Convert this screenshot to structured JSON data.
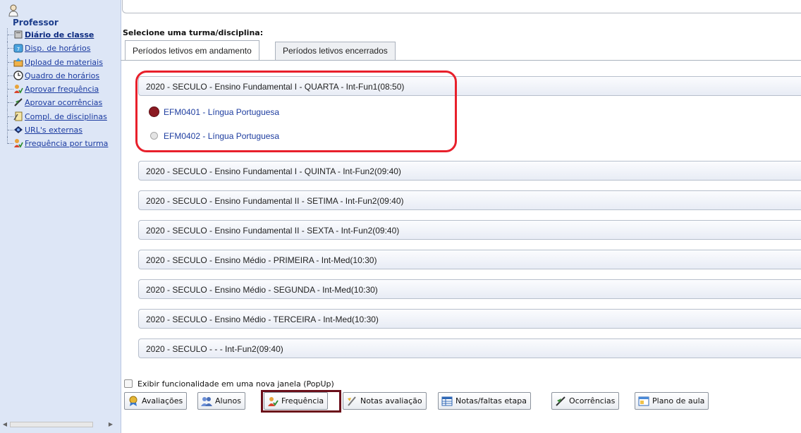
{
  "sidebar": {
    "title": "Professor",
    "items": [
      {
        "label": "Diário de classe",
        "icon": "book-icon"
      },
      {
        "label": "Disp. de horários",
        "icon": "calendar-icon"
      },
      {
        "label": "Upload de materiais",
        "icon": "upload-icon"
      },
      {
        "label": "Quadro de horários",
        "icon": "clock-icon"
      },
      {
        "label": "Aprovar frequência",
        "icon": "attendance-icon"
      },
      {
        "label": "Aprovar ocorrências",
        "icon": "occurrence-icon"
      },
      {
        "label": "Compl. de disciplinas",
        "icon": "complement-icon"
      },
      {
        "label": "URL's externas",
        "icon": "globe-icon"
      },
      {
        "label": "Frequência por turma",
        "icon": "attendance-icon"
      }
    ]
  },
  "main": {
    "select_label": "Selecione uma turma/disciplina:",
    "tabs": [
      {
        "label": "Períodos letivos em andamento",
        "active": true
      },
      {
        "label": "Períodos letivos encerrados",
        "active": false
      }
    ],
    "groups": [
      {
        "title": "2020 - SECULO  - Ensino Fundamental I - QUARTA - Int-Fun1(08:50)",
        "expanded": true,
        "disciplines": [
          {
            "label": "EFM0401 - Língua Portuguesa",
            "selected": true
          },
          {
            "label": "EFM0402 - Língua Portuguesa",
            "selected": false
          }
        ]
      },
      {
        "title": "2020 - SECULO  - Ensino Fundamental I - QUINTA - Int-Fun2(09:40)"
      },
      {
        "title": "2020 - SECULO  - Ensino Fundamental II - SETIMA - Int-Fun2(09:40)"
      },
      {
        "title": "2020 - SECULO  - Ensino Fundamental II - SEXTA - Int-Fun2(09:40)"
      },
      {
        "title": "2020 - SECULO  - Ensino Médio - PRIMEIRA - Int-Med(10:30)"
      },
      {
        "title": "2020 - SECULO  - Ensino Médio - SEGUNDA - Int-Med(10:30)"
      },
      {
        "title": "2020 - SECULO  - Ensino Médio - TERCEIRA - Int-Med(10:30)"
      },
      {
        "title": "2020 - SECULO  -  -  - Int-Fun2(09:40)"
      }
    ],
    "popup_checkbox_label": "Exibir funcionalidade em uma nova janela (PopUp)",
    "popup_checked": false,
    "buttons": [
      {
        "label": "Avaliações",
        "icon": "evaluation-icon"
      },
      {
        "label": "Alunos",
        "icon": "students-icon"
      },
      {
        "label": "Frequência",
        "icon": "attendance-icon"
      },
      {
        "label": "Notas avaliação",
        "icon": "grades-icon"
      },
      {
        "label": "Notas/faltas etapa",
        "icon": "table-icon"
      },
      {
        "label": "Ocorrências",
        "icon": "occurrence-icon"
      },
      {
        "label": "Plano de aula",
        "icon": "lesson-plan-icon"
      }
    ]
  },
  "colors": {
    "sidebar_bg": "#dde6f6",
    "link": "#1f3ea0",
    "highlight_red": "#e8202b",
    "selected_radio": "#8b1a22",
    "frequencia_mark": "#6b0f1a"
  }
}
